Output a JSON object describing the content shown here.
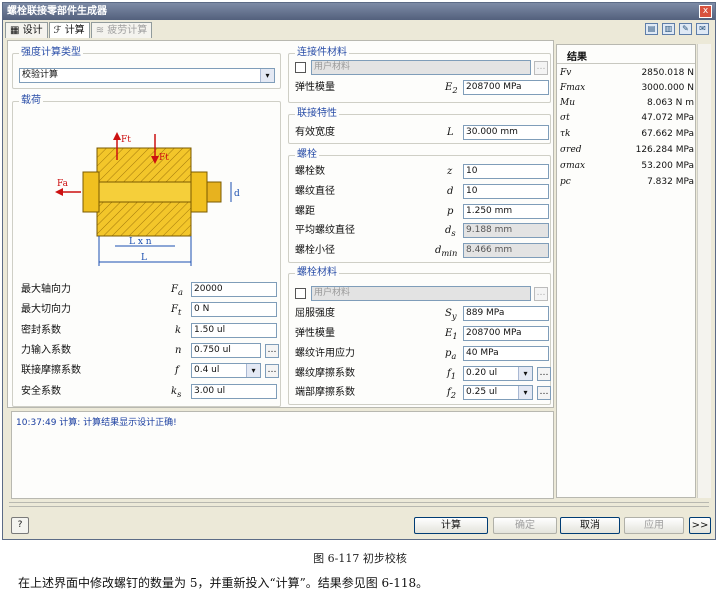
{
  "window": {
    "title": "螺栓联接零部件生成器",
    "close": "x"
  },
  "tabs": [
    {
      "label": "设计"
    },
    {
      "label": "计算"
    },
    {
      "label": "疲劳计算"
    }
  ],
  "strength": {
    "title": "强度计算类型",
    "value": "校验计算"
  },
  "load": {
    "title": "载荷",
    "figure": {
      "ft": "Ft",
      "fa": "Fa",
      "d": "d",
      "lxn": "L x n",
      "l": "L"
    }
  },
  "left_rows": [
    {
      "label": "最大轴向力",
      "sym": "F",
      "sub": "a",
      "value": "20000",
      "dots": false
    },
    {
      "label": "最大切向力",
      "sym": "F",
      "sub": "t",
      "value": "0 N",
      "dots": false
    },
    {
      "label": "密封系数",
      "sym": "k",
      "sub": "",
      "value": "1.50 ul",
      "dots": false
    },
    {
      "label": "力输入系数",
      "sym": "n",
      "sub": "",
      "value": "0.750 ul",
      "dots": true
    },
    {
      "label": "联接摩擦系数",
      "sym": "f",
      "sub": "",
      "value": "0.4 ul",
      "dots": true
    },
    {
      "label": "安全系数",
      "sym": "k",
      "sub": "s",
      "value": "3.00 ul",
      "dots": false
    }
  ],
  "conn_mat": {
    "title": "连接件材料",
    "user_mat": "用户材料",
    "row": {
      "label": "弹性模量",
      "sym": "E",
      "sub": "2",
      "value": "208700 MPa"
    }
  },
  "conn_char": {
    "title": "联接特性",
    "row": {
      "label": "有效宽度",
      "sym": "L",
      "sub": "",
      "value": "30.000 mm"
    }
  },
  "bolt": {
    "title": "螺栓",
    "rows": [
      {
        "label": "螺栓数",
        "sym": "z",
        "sub": "",
        "value": "10",
        "ro": false
      },
      {
        "label": "螺纹直径",
        "sym": "d",
        "sub": "",
        "value": "10",
        "ro": false
      },
      {
        "label": "螺距",
        "sym": "p",
        "sub": "",
        "value": "1.250 mm",
        "ro": false
      },
      {
        "label": "平均螺纹直径",
        "sym": "d",
        "sub": "s",
        "value": "9.188 mm",
        "ro": true
      },
      {
        "label": "螺栓小径",
        "sym": "d",
        "sub": "min",
        "value": "8.466 mm",
        "ro": true
      }
    ]
  },
  "bolt_mat": {
    "title": "螺栓材料",
    "user_mat": "用户材料",
    "rows": [
      {
        "label": "屈服强度",
        "sym": "S",
        "sub": "y",
        "value": "889 MPa",
        "dots": false
      },
      {
        "label": "弹性模量",
        "sym": "E",
        "sub": "1",
        "value": "208700 MPa",
        "dots": false
      },
      {
        "label": "螺纹许用应力",
        "sym": "p",
        "sub": "a",
        "value": "40 MPa",
        "dots": false
      },
      {
        "label": "螺纹摩擦系数",
        "sym": "f",
        "sub": "1",
        "value": "0.20 ul",
        "dots": true
      },
      {
        "label": "端部摩擦系数",
        "sym": "f",
        "sub": "2",
        "value": "0.25 ul",
        "dots": true
      }
    ]
  },
  "results": {
    "title": "结果",
    "rows": [
      {
        "key": "Fv",
        "value": "2850.018 N"
      },
      {
        "key": "Fmax",
        "value": "3000.000 N"
      },
      {
        "key": "Mu",
        "value": "8.063 N m"
      },
      {
        "key": "σt",
        "value": "47.072 MPa"
      },
      {
        "key": "τk",
        "value": "67.662 MPa"
      },
      {
        "key": "σred",
        "value": "126.284 MPa"
      },
      {
        "key": "σmax",
        "value": "53.200 MPa"
      },
      {
        "key": "pc",
        "value": "7.832 MPa"
      }
    ]
  },
  "log": {
    "text": "10:37:49 计算: 计算结果显示设计正确!"
  },
  "buttons": {
    "calc": "计算",
    "ok": "确定",
    "cancel": "取消",
    "apply": "应用",
    "more": ">>"
  },
  "caption": "图 6-117 初步校核",
  "body_text": "在上述界面中修改螺钉的数量为 5，并重新投入“计算”。结果参见图 6-118。"
}
